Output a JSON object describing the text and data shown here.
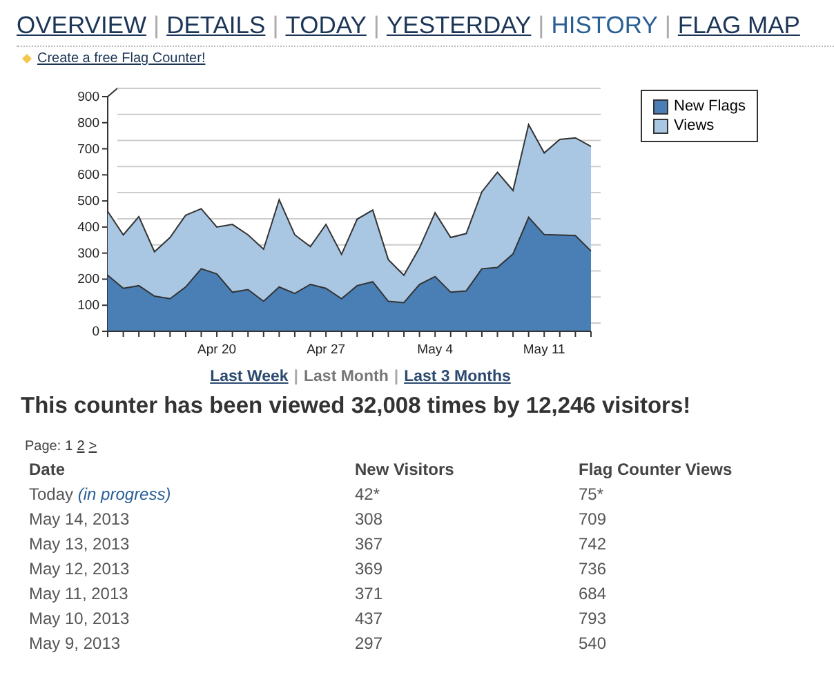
{
  "nav": [
    {
      "label": "OVERVIEW",
      "selected": false
    },
    {
      "label": "DETAILS",
      "selected": false
    },
    {
      "label": "TODAY",
      "selected": false
    },
    {
      "label": "YESTERDAY",
      "selected": false
    },
    {
      "label": "HISTORY",
      "selected": true
    },
    {
      "label": "FLAG MAP",
      "selected": false
    }
  ],
  "nav_separator": "|",
  "promo_link": "Create a free Flag Counter!",
  "chart": {
    "chart_data": {
      "type": "area",
      "categories": [
        null,
        null,
        null,
        null,
        null,
        null,
        null,
        "Apr 20",
        null,
        null,
        null,
        null,
        null,
        null,
        "Apr 27",
        null,
        null,
        null,
        null,
        null,
        null,
        "May 4",
        null,
        null,
        null,
        null,
        null,
        null,
        "May 11",
        null,
        null,
        null
      ],
      "series": [
        {
          "name": "Views",
          "color": "#a9c7e3",
          "values": [
            460,
            370,
            440,
            305,
            360,
            445,
            470,
            400,
            410,
            370,
            315,
            505,
            370,
            325,
            410,
            295,
            430,
            465,
            275,
            215,
            320,
            455,
            360,
            375,
            535,
            610,
            540,
            793,
            684,
            736,
            742,
            709
          ]
        },
        {
          "name": "New Flags",
          "color": "#4a7fb5",
          "values": [
            215,
            165,
            175,
            135,
            125,
            170,
            240,
            220,
            150,
            160,
            115,
            170,
            145,
            180,
            165,
            125,
            175,
            190,
            115,
            110,
            180,
            210,
            150,
            155,
            240,
            245,
            297,
            437,
            371,
            369,
            367,
            308
          ]
        }
      ],
      "ylim": [
        0,
        900
      ],
      "yticks": [
        0,
        100,
        200,
        300,
        400,
        500,
        600,
        700,
        800,
        900
      ]
    }
  },
  "ranges": [
    {
      "label": "Last Week",
      "selected": false
    },
    {
      "label": "Last Month",
      "selected": true
    },
    {
      "label": "Last 3 Months",
      "selected": false
    }
  ],
  "range_separator": "|",
  "summary": "This counter has been viewed 32,008 times by 12,246 visitors!",
  "pager": {
    "label": "Page:",
    "pages": [
      {
        "label": "1",
        "selected": true
      },
      {
        "label": "2",
        "selected": false
      }
    ],
    "next": ">"
  },
  "table": {
    "columns": [
      "Date",
      "New Visitors",
      "Flag Counter Views"
    ],
    "rows": [
      {
        "date": "Today",
        "note": "(in progress)",
        "new_visitors": "42*",
        "views": "75*"
      },
      {
        "date": "May 14, 2013",
        "new_visitors": "308",
        "views": "709"
      },
      {
        "date": "May 13, 2013",
        "new_visitors": "367",
        "views": "742"
      },
      {
        "date": "May 12, 2013",
        "new_visitors": "369",
        "views": "736"
      },
      {
        "date": "May 11, 2013",
        "new_visitors": "371",
        "views": "684"
      },
      {
        "date": "May 10, 2013",
        "new_visitors": "437",
        "views": "793"
      },
      {
        "date": "May 9, 2013",
        "new_visitors": "297",
        "views": "540"
      }
    ]
  }
}
